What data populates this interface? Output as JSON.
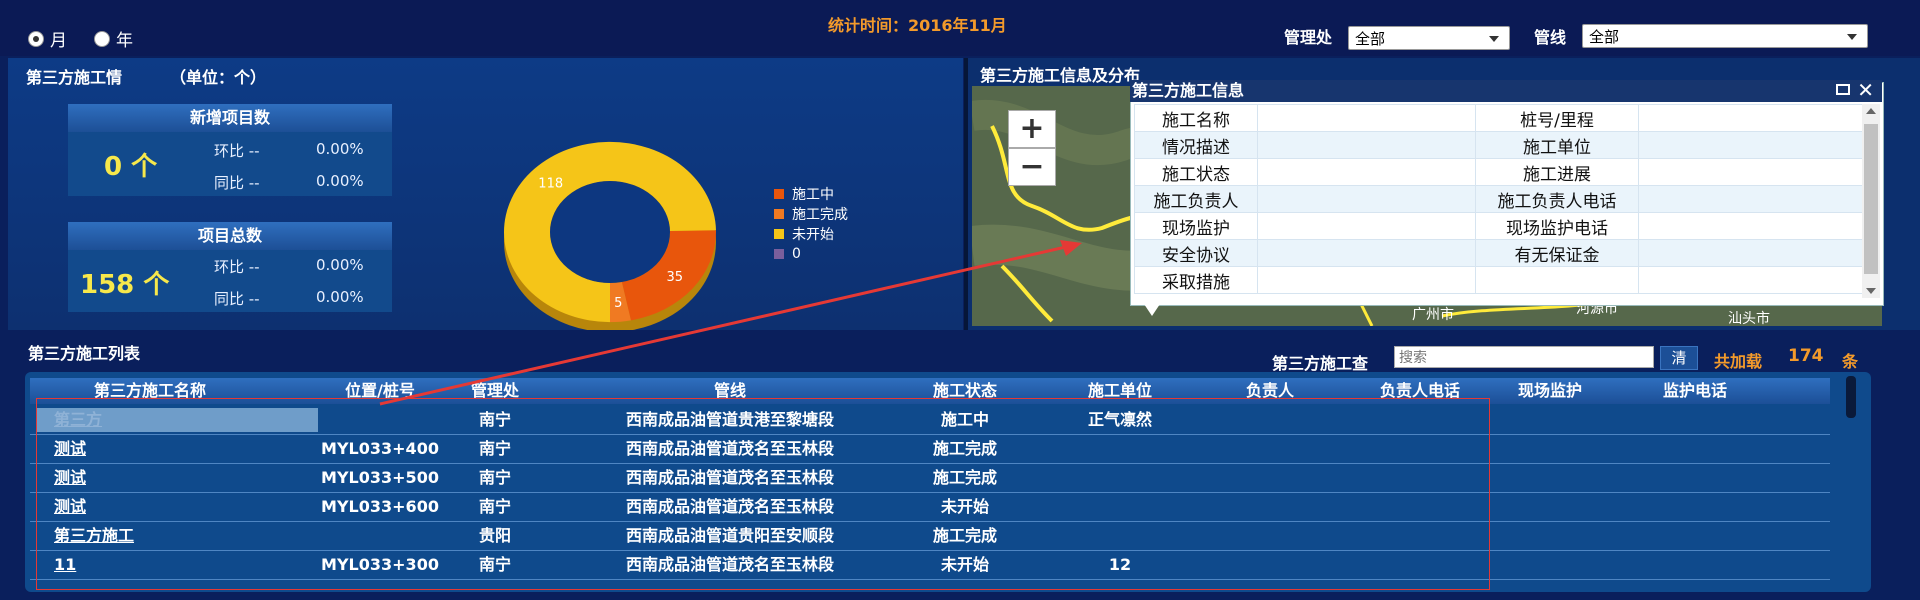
{
  "top": {
    "period_options": [
      {
        "label": "月",
        "selected": true
      },
      {
        "label": "年",
        "selected": false
      }
    ],
    "stat_time": "统计时间：2016年11月",
    "dept_label": "管理处",
    "dept_value": "全部",
    "pipeline_label": "管线",
    "pipeline_value": "全部"
  },
  "summary": {
    "title": "第三方施工情",
    "unit": "（单位：个）",
    "new_projects": {
      "header": "新增项目数",
      "value": "0 个",
      "mom_label": "环比 --",
      "mom_value": "0.00%",
      "yoy_label": "同比 --",
      "yoy_value": "0.00%"
    },
    "total_projects": {
      "header": "项目总数",
      "value": "158 个",
      "mom_label": "环比 --",
      "mom_value": "0.00%",
      "yoy_label": "同比 --",
      "yoy_value": "0.00%"
    }
  },
  "chart_data": {
    "type": "pie",
    "categories": [
      "施工中",
      "施工完成",
      "未开始",
      "0"
    ],
    "values": [
      35,
      5,
      118,
      0
    ],
    "colors": [
      "#e8560c",
      "#f07a22",
      "#f5c518",
      "#7a5f9c"
    ],
    "legend_position": "right"
  },
  "map": {
    "title": "第三方施工信息及分布",
    "zoom_in": "+",
    "zoom_out": "−",
    "places": [
      "广州市",
      "河源市",
      "汕头市"
    ],
    "info": {
      "title": "第三方施工信息",
      "rows": [
        [
          "施工名称",
          "桩号/里程"
        ],
        [
          "情况描述",
          "施工单位"
        ],
        [
          "施工状态",
          "施工进展"
        ],
        [
          "施工负责人",
          "施工负责人电话"
        ],
        [
          "现场监护",
          "现场监护电话"
        ],
        [
          "安全协议",
          "有无保证金"
        ],
        [
          "采取措施",
          ""
        ]
      ]
    }
  },
  "list": {
    "title": "第三方施工列表",
    "search_label": "第三方施工查",
    "search_placeholder": "搜索",
    "search_button": "清",
    "total_prefix": "共加载",
    "total_count": "174",
    "total_suffix": "条",
    "columns": [
      "第三方施工名称",
      "位置/桩号",
      "管理处",
      "管线",
      "施工状态",
      "施工单位",
      "负责人",
      "负责人电话",
      "现场监护",
      "监护电话"
    ],
    "rows": [
      [
        "第三方",
        "",
        "南宁",
        "西南成品油管道贵港至黎塘段",
        "施工中",
        "正气凛然",
        "",
        "",
        "",
        ""
      ],
      [
        "测试",
        "MYL033+400",
        "南宁",
        "西南成品油管道茂名至玉林段",
        "施工完成",
        "",
        "",
        "",
        "",
        ""
      ],
      [
        "测试",
        "MYL033+500",
        "南宁",
        "西南成品油管道茂名至玉林段",
        "施工完成",
        "",
        "",
        "",
        "",
        ""
      ],
      [
        "测试",
        "MYL033+600",
        "南宁",
        "西南成品油管道茂名至玉林段",
        "未开始",
        "",
        "",
        "",
        "",
        ""
      ],
      [
        "第三方施工",
        "",
        "贵阳",
        "西南成品油管道贵阳至安顺段",
        "施工完成",
        "",
        "",
        "",
        "",
        ""
      ],
      [
        "11",
        "MYL033+300",
        "南宁",
        "西南成品油管道茂名至玉林段",
        "未开始",
        "12",
        "",
        "",
        "",
        ""
      ]
    ]
  }
}
